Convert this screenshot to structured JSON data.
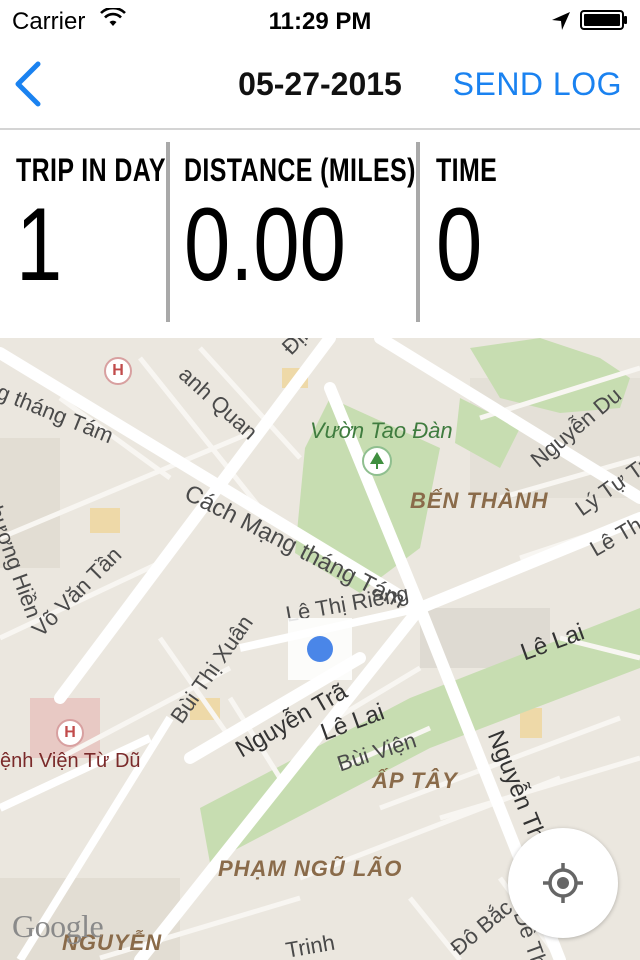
{
  "status_bar": {
    "carrier": "Carrier",
    "time": "11:29 PM",
    "icons": [
      "wifi-icon",
      "location-arrow-icon",
      "battery-icon"
    ]
  },
  "nav": {
    "title": "05-27-2015",
    "send_log_label": "SEND LOG",
    "back_icon": "chevron-left-icon",
    "accent_color": "#1a82f0"
  },
  "stats": {
    "trip_in_day_label": "TRIP IN DAY",
    "trip_in_day_value": "1",
    "distance_label": "DISTANCE (MILES)",
    "distance_value": "0.00",
    "time_label": "TIME",
    "time_value": "0"
  },
  "map": {
    "streets": {
      "cmtt_top": "g tháng Tám",
      "thanh_quan": "anh Quan",
      "dinh": "Định",
      "nguyen_du": "Nguyễn Du",
      "ly_tu_trong": "Lý Tự Trọ",
      "le_thanh": "Lê Thá",
      "cmtt_main": "Cách Mạng tháng Tám",
      "thuong_hien": "hương Hiền",
      "vo_van_tan": "Võ Văn Tần",
      "le_thi_rieng": "Lê Thị Riêng",
      "le_lai_right": "Lê Lai",
      "bui_thi_xuan": "Bùi Thị Xuân",
      "nguyen_trai": "Nguyễn Trã",
      "le_lai_mid": "Lê Lai",
      "bui_vien": "Bùi Viện",
      "nguyen_thai_hoc": "Nguyễn Thá",
      "de_tham": "Đề Thám",
      "pho_bac": "Đô Bắc",
      "trinh": "Trinh"
    },
    "park_name": "Vườn Tao Đàn",
    "districts": {
      "ben_thanh": "BẾN THÀNH",
      "ap_tay": "ẤP TÂY",
      "pham_ngu_lao": "PHẠM NGŨ LÃO",
      "nguyen_bottom": "NGUYỄN"
    },
    "hospital_name": "ệnh Viện Từ Dũ",
    "hospital_badge": "H",
    "google_logo": "Google",
    "locate_icon": "crosshair-icon"
  }
}
